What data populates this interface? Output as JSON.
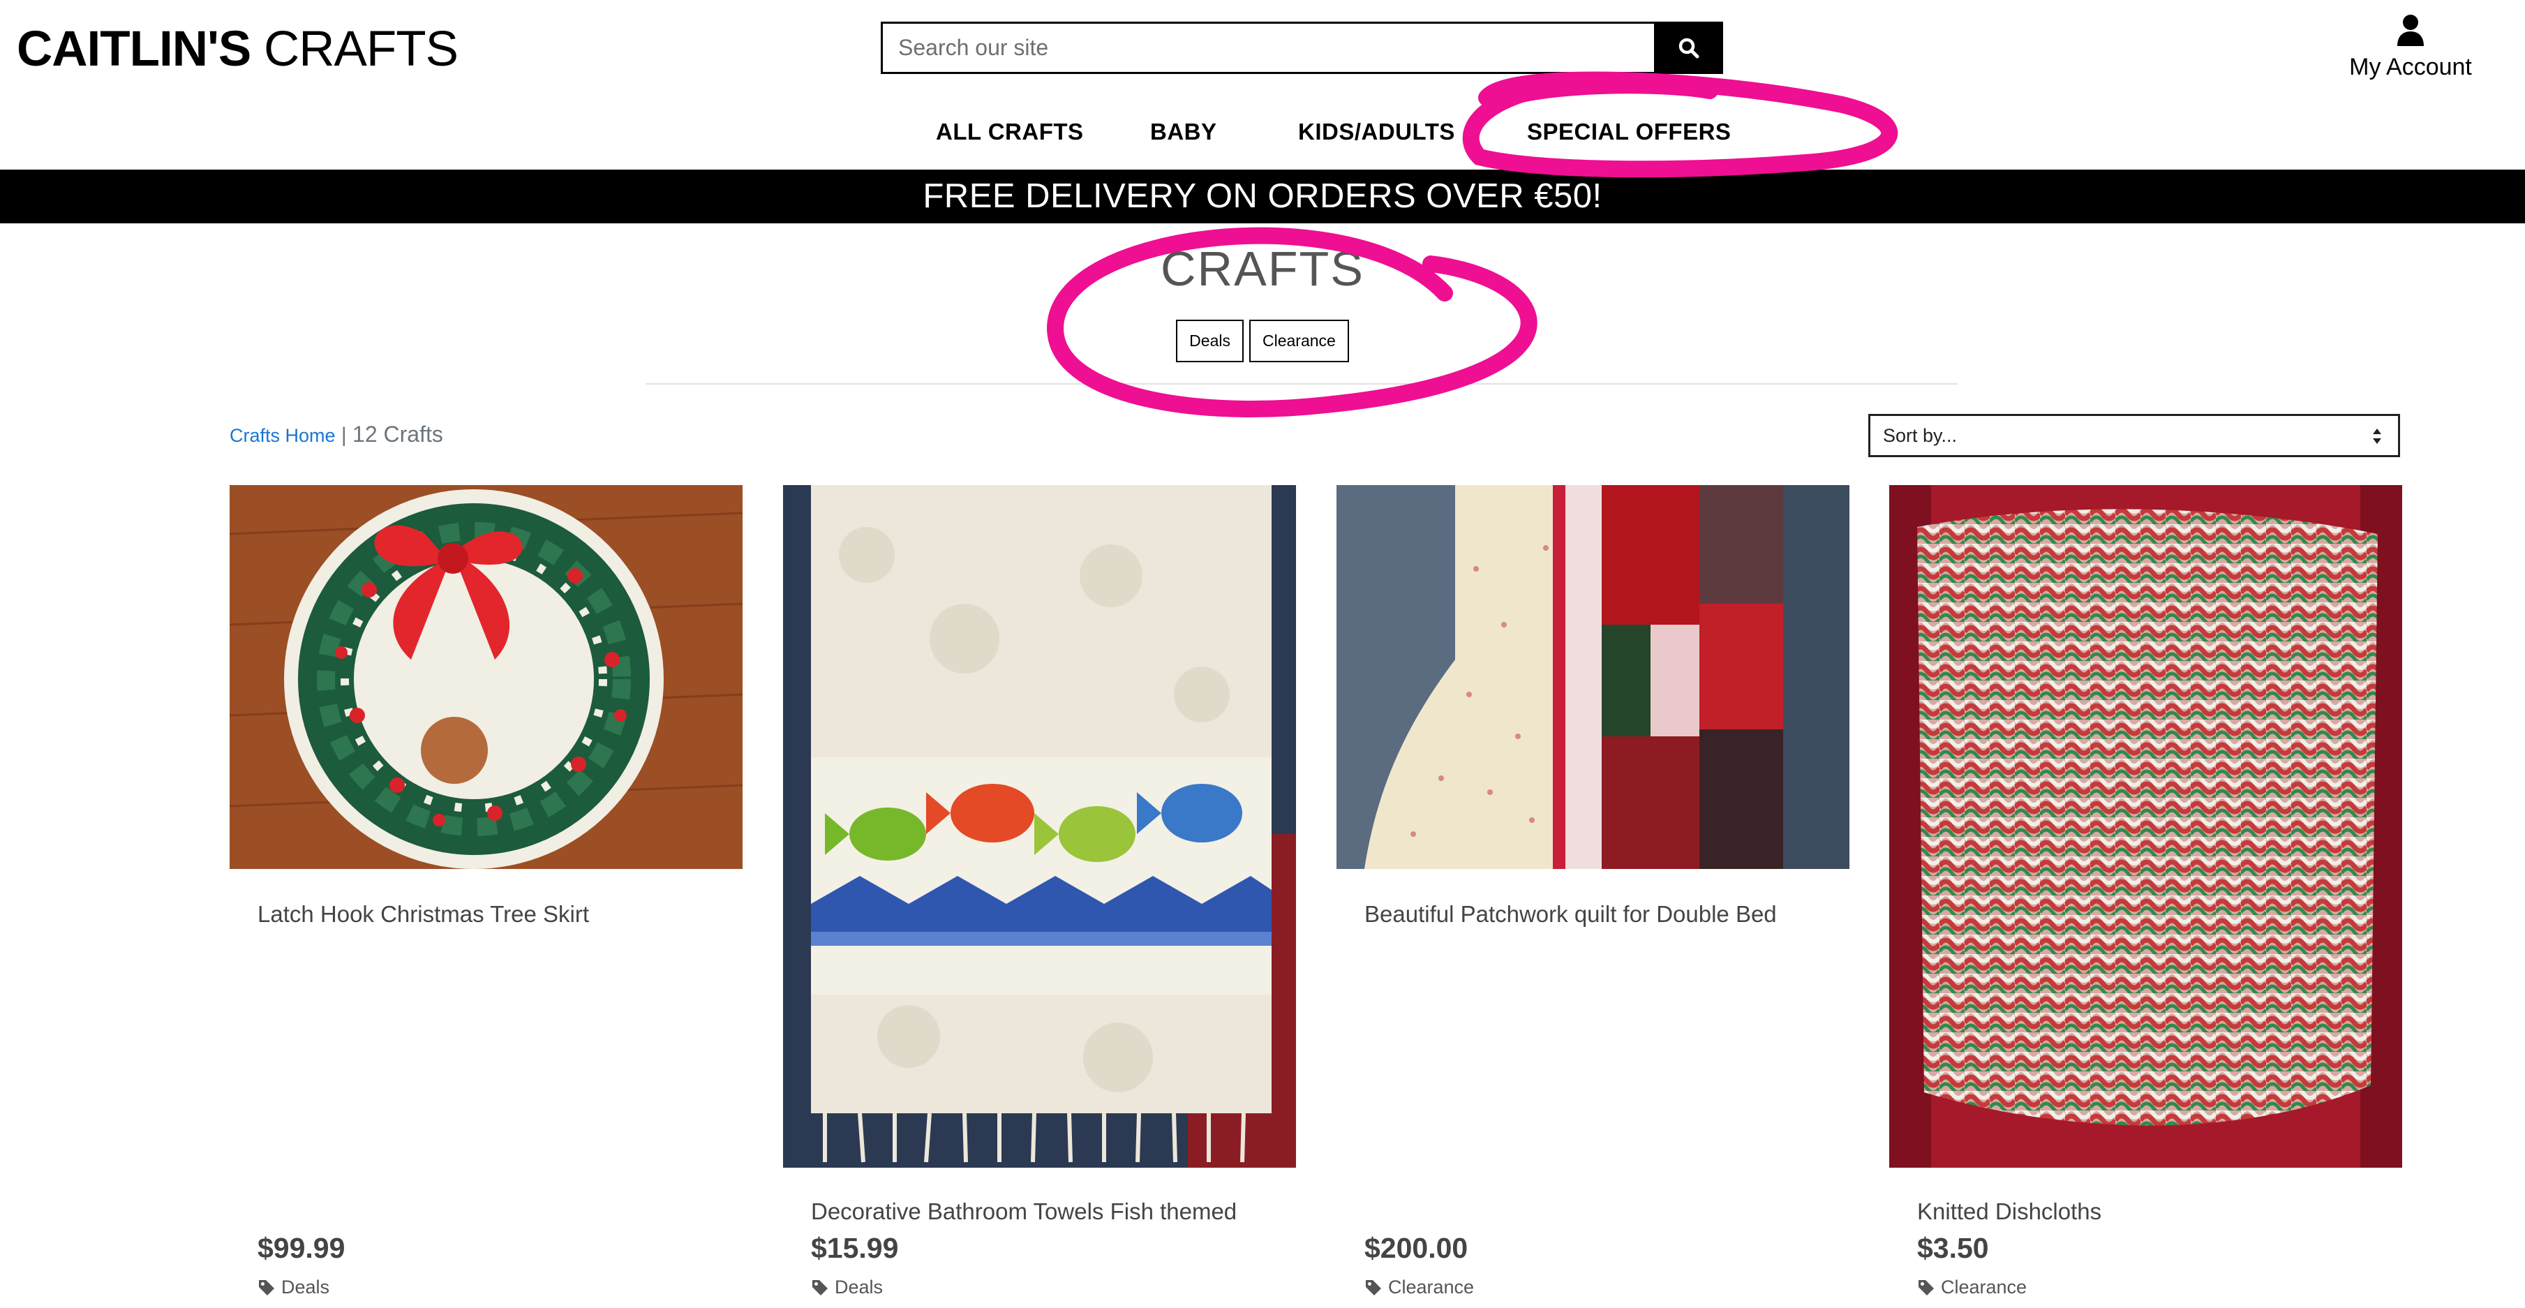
{
  "header": {
    "logo_bold": "CAITLIN'S",
    "logo_light": "CRAFTS",
    "search_placeholder": "Search our site",
    "account_label": "My Account"
  },
  "nav": {
    "items": [
      "ALL CRAFTS",
      "BABY",
      "KIDS/ADULTS",
      "SPECIAL OFFERS"
    ]
  },
  "banner": {
    "text": "FREE DELIVERY ON ORDERS OVER €50!"
  },
  "page": {
    "title": "CRAFTS",
    "filters": [
      "Deals",
      "Clearance"
    ]
  },
  "breadcrumb": {
    "home_link": "Crafts Home",
    "separator": " | ",
    "count": "12 Crafts"
  },
  "sort": {
    "selected": "Sort by..."
  },
  "products": [
    {
      "name": "Latch Hook Christmas Tree Skirt",
      "price": "$99.99",
      "tag": "Deals"
    },
    {
      "name": "Decorative Bathroom Towels Fish themed",
      "price": "$15.99",
      "tag": "Deals"
    },
    {
      "name": "Beautiful Patchwork quilt for Double Bed",
      "price": "$200.00",
      "tag": "Clearance"
    },
    {
      "name": "Knitted Dishcloths",
      "price": "$3.50",
      "tag": "Clearance"
    }
  ],
  "icons": {
    "search": "search-icon",
    "account": "user-icon",
    "sort": "sort-caret-icon",
    "tag": "tag-icon"
  },
  "colors": {
    "banner_bg": "#000000",
    "link": "#1976d2",
    "annotation": "#ee0f92"
  }
}
